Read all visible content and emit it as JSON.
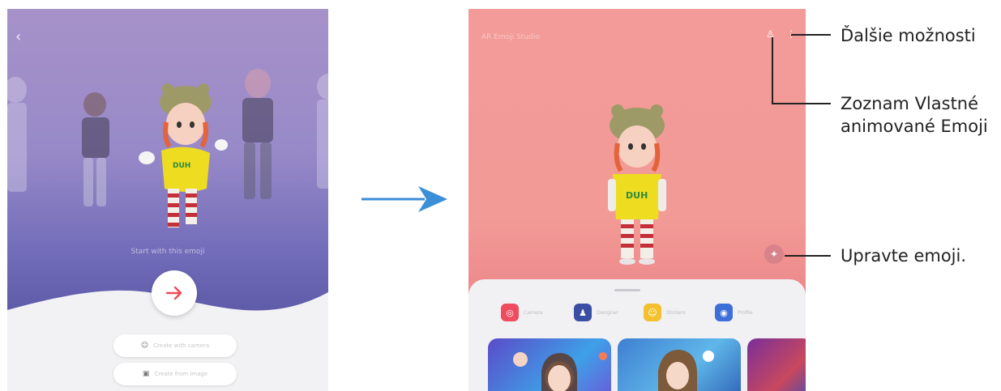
{
  "left_screen": {
    "back_icon": "chevron-left-icon",
    "start_caption": "Start with this emoji",
    "next_icon": "arrow-right-icon",
    "create_with_camera": "Create with camera",
    "create_from_image": "Create from image"
  },
  "right_screen": {
    "title": "AR Emoji Studio",
    "tabs": [
      {
        "label": "Camera",
        "icon": "camera-icon",
        "color": "#ef4c5f"
      },
      {
        "label": "Designer",
        "icon": "designer-icon",
        "color": "#3a4fa3"
      },
      {
        "label": "Stickers",
        "icon": "sticker-icon",
        "color": "#f3c02f"
      },
      {
        "label": "Profile",
        "icon": "profile-icon",
        "color": "#3d6fd9"
      }
    ]
  },
  "callouts": {
    "more_options": "Ďalšie možnosti",
    "emoji_list_line1": "Zoznam Vlastné",
    "emoji_list_line2": "animované Emoji",
    "edit_emoji": "Upravte emoji."
  },
  "colors": {
    "arrow": "#3b8fd8",
    "left_bg": "#9789c8",
    "right_bg": "#f29a96"
  }
}
